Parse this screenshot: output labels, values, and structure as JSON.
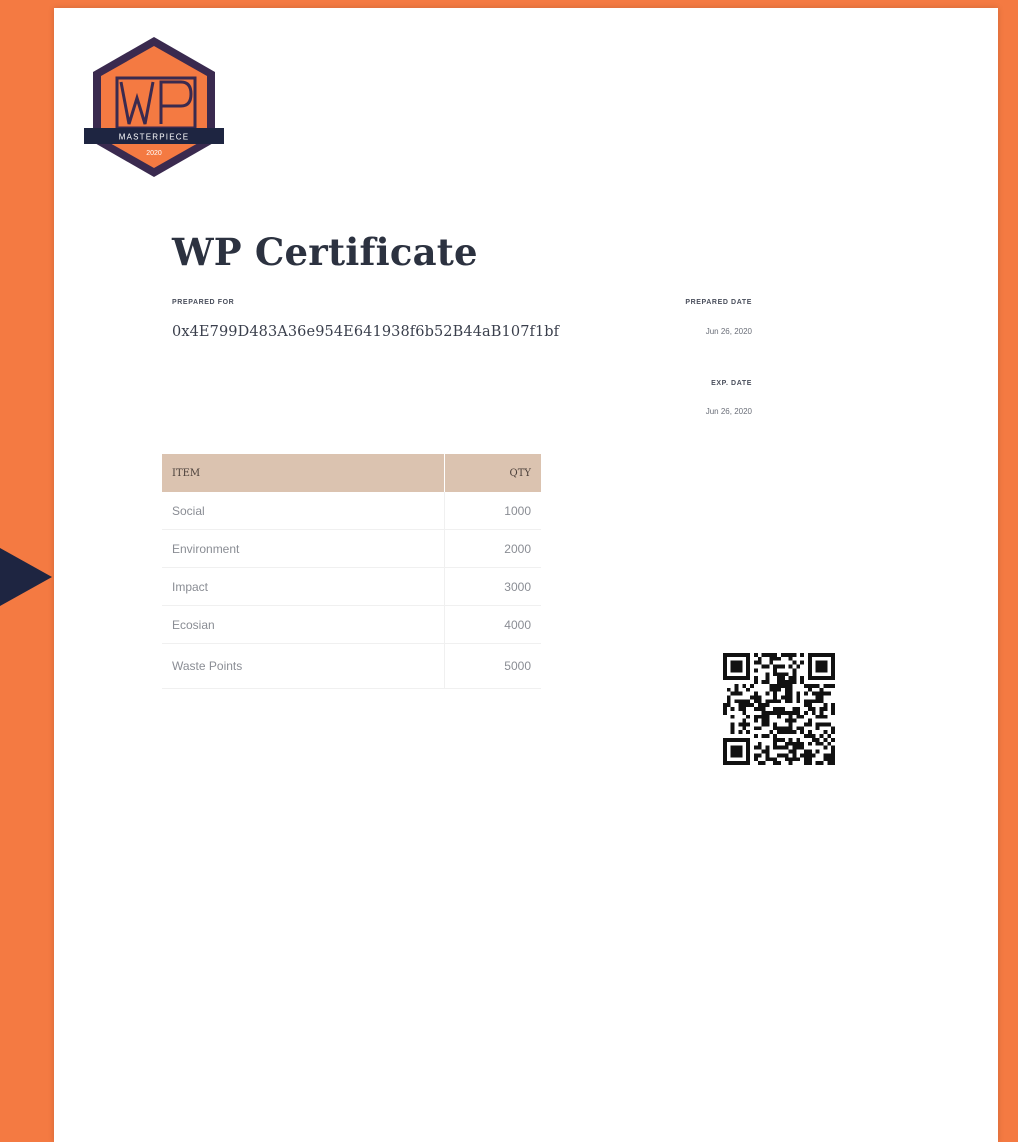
{
  "logo": {
    "text_top": "WP",
    "banner": "MASTERPIECE",
    "year": "2020",
    "colors": {
      "frame": "#3a2a4f",
      "fill": "#f47a42",
      "banner": "#1e2541"
    }
  },
  "certificate": {
    "title": "WP Certificate",
    "prepared_for_label": "PREPARED FOR",
    "address": "0x4E799D483A36e954E641938f6b52B44aB107f1bf",
    "prepared_date_label": "PREPARED DATE",
    "prepared_date": "Jun 26, 2020",
    "exp_date_label": "EXP. DATE",
    "exp_date": "Jun 26, 2020"
  },
  "table": {
    "headers": {
      "item": "ITEM",
      "qty": "QTY"
    },
    "rows": [
      {
        "item": "Social",
        "qty": "1000"
      },
      {
        "item": "Environment",
        "qty": "2000"
      },
      {
        "item": "Impact",
        "qty": "3000"
      },
      {
        "item": "Ecosian",
        "qty": "4000"
      },
      {
        "item": "Waste Points",
        "qty": "5000"
      }
    ]
  },
  "colors": {
    "background": "#f47a42",
    "header_row": "#dbc3b0",
    "title_text": "#2c3240",
    "arrow": "#1e2541"
  }
}
